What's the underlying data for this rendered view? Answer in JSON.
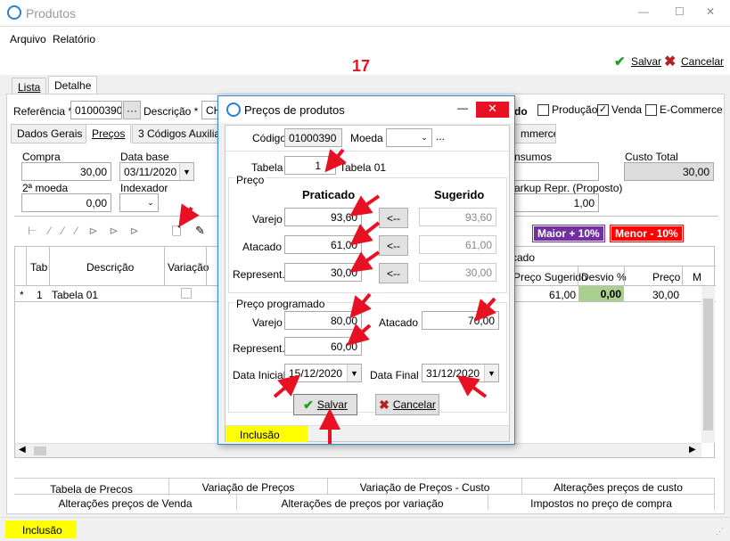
{
  "window": {
    "title": "Produtos",
    "min": "—",
    "max": "☐",
    "close": "✕"
  },
  "menu": [
    "Arquivo",
    "Relatório"
  ],
  "toolbar": {
    "save": "Salvar",
    "cancel": "Cancelar",
    "step": "17"
  },
  "main_tabs": [
    "Lista",
    "Detalhe"
  ],
  "header": {
    "ref_label": "Referência *",
    "ref_value": "01000390",
    "desc_label": "Descrição *",
    "desc_value": "CH",
    "producao": "Produção",
    "venda": "Venda",
    "ecommerce": "E-Commerce",
    "frag": "do"
  },
  "sub_tabs": [
    "Dados Gerais",
    "Preços",
    "3 Códigos Auxiliare",
    "mmerce"
  ],
  "costs": {
    "compra_label": "Compra",
    "compra_value": "30,00",
    "database_label": "Data base",
    "database_value": "03/11/2020",
    "moeda2_label": "2ª moeda",
    "moeda2_value": "0,00",
    "indexador_label": "Indexador",
    "insumos_label": "nsumos",
    "custo_total_label": "Custo Total",
    "custo_total_value": "30,00",
    "markup_label": "arkup Repr. (Proposto)",
    "markup_value": "1,00"
  },
  "badges": {
    "maior": "Maior + 10%",
    "menor": "Menor - 10%"
  },
  "grid": {
    "headers": [
      "Tab",
      "Descrição",
      "Variação"
    ],
    "row": {
      "marker": "*",
      "tab": "1",
      "descricao": "Tabela 01"
    }
  },
  "grid_right": {
    "group": "cado",
    "headers": [
      "Preço Sugerido",
      "Desvio %",
      "Preço",
      "M"
    ],
    "row": [
      "61,00",
      "0,00",
      "30,00"
    ]
  },
  "bottom_tabs_row1": [
    "Tabela de Precos",
    "Variação de Preços",
    "Variação de Preços - Custo",
    "Alterações preços de custo"
  ],
  "bottom_tabs_row2": [
    "Alterações preços de Venda",
    "Alterações de preços por variação",
    "Impostos no preço de compra"
  ],
  "status": "Inclusão",
  "dialog": {
    "title": "Preços de produtos",
    "codigo_label": "Código",
    "codigo_value": "01000390",
    "moeda_label": "Moeda",
    "ellipsis": "...",
    "tabela_label": "Tabela",
    "tabela_value": "1",
    "tabela_name": "Tabela 01",
    "preco_group": "Preço",
    "praticado": "Praticado",
    "sugerido": "Sugerido",
    "varejo_label": "Varejo",
    "varejo_value": "93,60",
    "varejo_sug": "93,60",
    "atacado_label": "Atacado",
    "atacado_value": "61,00",
    "atacado_sug": "61,00",
    "repr_label": "Represent.",
    "repr_value": "30,00",
    "repr_sug": "30,00",
    "copy_btn": "<--",
    "prog_group": "Preço programado",
    "prog_varejo_label": "Varejo",
    "prog_varejo_value": "80,00",
    "prog_atacado_label": "Atacado",
    "prog_atacado_value": "70,00",
    "prog_repr_label": "Represent.",
    "prog_repr_value": "60,00",
    "data_ini_label": "Data Inicial",
    "data_ini_value": "15/12/2020",
    "data_fim_label": "Data Final",
    "data_fim_value": "31/12/2020",
    "save": "Salvar",
    "cancel": "Cancelar",
    "status": "Inclusão"
  },
  "colors": {
    "accent_red": "#e81123",
    "badge_purple": "#7030a0",
    "badge_red": "#ff0000",
    "status_yellow": "#ffff00",
    "desvio_green": "#a9d08e"
  }
}
